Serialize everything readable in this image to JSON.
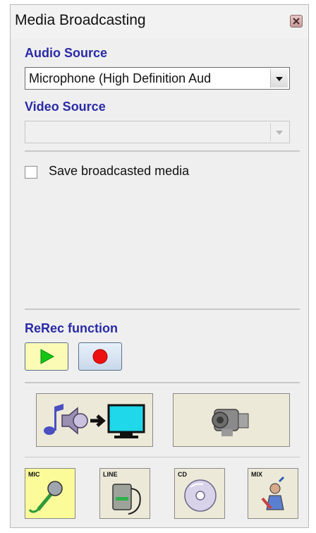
{
  "window": {
    "title": "Media Broadcasting"
  },
  "audio": {
    "label": "Audio Source",
    "selected": "Microphone (High Definition Aud"
  },
  "video": {
    "label": "Video Source",
    "selected": ""
  },
  "save": {
    "label": "Save broadcasted media",
    "checked": false
  },
  "rerec": {
    "label": "ReRec function"
  },
  "sources": {
    "mic": "MIC",
    "line": "LINE",
    "cd": "CD",
    "mix": "MIX"
  },
  "colors": {
    "accent_label": "#2a2aa6",
    "window_bg": "#efefef",
    "play_bg": "#fbfbb6",
    "selected_source_bg": "#fbfb9a"
  },
  "icons": {
    "close": "close-icon",
    "play": "play-icon",
    "record": "record-icon",
    "broadcast_audio": "audio-to-screen-icon",
    "camera": "video-camera-icon"
  }
}
